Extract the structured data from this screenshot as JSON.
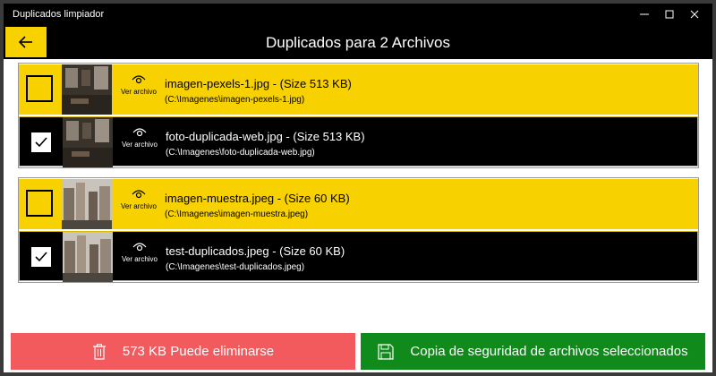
{
  "app_title": "Duplicados limpiador",
  "header": {
    "title": "Duplicados para 2 Archivos"
  },
  "view_label": "Ver archivo",
  "groups": [
    {
      "files": [
        {
          "name": "imagen-pexels-1.jpg - (Size 513 KB)",
          "path": "(C:\\Imagenes\\imagen-pexels-1.jpg)",
          "selected": false
        },
        {
          "name": "foto-duplicada-web.jpg - (Size 513 KB)",
          "path": "(C:\\Imagenes\\foto-duplicada-web.jpg)",
          "selected": true
        }
      ]
    },
    {
      "files": [
        {
          "name": "imagen-muestra.jpeg - (Size 60 KB)",
          "path": "(C:\\Imagenes\\imagen-muestra.jpeg)",
          "selected": false
        },
        {
          "name": "test-duplicados.jpeg - (Size 60 KB)",
          "path": "(C:\\Imagenes\\test-duplicados.jpeg)",
          "selected": true
        }
      ]
    }
  ],
  "actions": {
    "delete_label": "573 KB Puede eliminarse",
    "backup_label": "Copia de seguridad de archivos seleccionados"
  },
  "colors": {
    "accent": "#f7d200",
    "delete": "#f25a5e",
    "backup": "#108a1a"
  },
  "icons": [
    "back-arrow-icon",
    "eye-icon",
    "trash-icon",
    "save-icon",
    "checkmark-icon"
  ]
}
